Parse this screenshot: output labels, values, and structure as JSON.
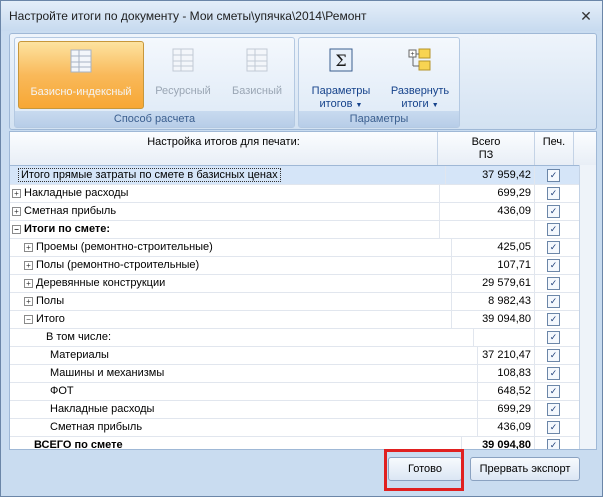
{
  "window": {
    "title": "Настройте итоги по документу - Мои сметы\\упячка\\2014\\Ремонт",
    "close_label": "✕"
  },
  "ribbon": {
    "group1": {
      "label": "Способ расчета",
      "buttons": [
        {
          "label": "Базисно-индексный",
          "icon": "table-icon",
          "state": "active"
        },
        {
          "label": "Ресурсный",
          "icon": "table-icon",
          "state": "disabled"
        },
        {
          "label": "Базисный",
          "icon": "table-icon",
          "state": "disabled"
        }
      ]
    },
    "group2": {
      "label": "Параметры",
      "buttons": [
        {
          "label": "Параметры",
          "label2": "итогов",
          "icon": "sigma-icon"
        },
        {
          "label": "Развернуть",
          "label2": "итоги",
          "icon": "expand-tree-icon"
        }
      ]
    }
  },
  "grid": {
    "headers": {
      "name": "Настройка итогов для печати:",
      "total_line1": "Всего",
      "total_line2": "ПЗ",
      "print": "Печ."
    },
    "rows": [
      {
        "expander": "",
        "label": "Итого прямые затраты по смете в базисных ценах",
        "value": "37 959,42",
        "checked": true
      },
      {
        "expander": "+",
        "label": "Накладные расходы",
        "value": "699,29",
        "checked": true
      },
      {
        "expander": "+",
        "label": "Сметная прибыль",
        "value": "436,09",
        "checked": true
      },
      {
        "expander": "−",
        "label": "Итоги по смете:",
        "value": "",
        "checked": true
      },
      {
        "expander": "+",
        "label": "Проемы (ремонтно-строительные)",
        "value": "425,05",
        "checked": true
      },
      {
        "expander": "+",
        "label": "Полы (ремонтно-строительные)",
        "value": "107,71",
        "checked": true
      },
      {
        "expander": "+",
        "label": "Деревянные конструкции",
        "value": "29 579,61",
        "checked": true
      },
      {
        "expander": "+",
        "label": "Полы",
        "value": "8 982,43",
        "checked": true
      },
      {
        "expander": "−",
        "label": "Итого",
        "value": "39 094,80",
        "checked": true
      },
      {
        "expander": "",
        "label": "В том числе:",
        "value": "",
        "checked": true
      },
      {
        "expander": "",
        "label": "Материалы",
        "value": "37 210,47",
        "checked": true
      },
      {
        "expander": "",
        "label": "Машины и механизмы",
        "value": "108,83",
        "checked": true
      },
      {
        "expander": "",
        "label": "ФОТ",
        "value": "648,52",
        "checked": true
      },
      {
        "expander": "",
        "label": "Накладные расходы",
        "value": "699,29",
        "checked": true
      },
      {
        "expander": "",
        "label": "Сметная прибыль",
        "value": "436,09",
        "checked": true
      },
      {
        "expander": "",
        "label": "ВСЕГО по смете",
        "value": "39 094,80",
        "checked": true
      }
    ]
  },
  "footer": {
    "ok_label": "Готово",
    "abort_label": "Прервать экспорт"
  },
  "colors": {
    "highlight": "#e02020",
    "selected_row": "#d5e5f8",
    "active_button": "#f9b95a"
  }
}
